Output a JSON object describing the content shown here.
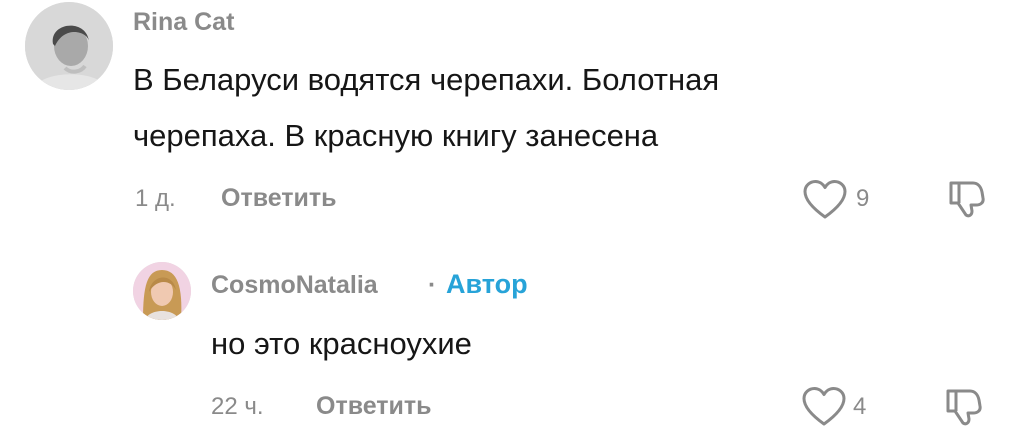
{
  "comments": [
    {
      "username": "Rina Cat",
      "text_lines": [
        "В Беларуси водятся черепахи. Болотная",
        "черепаха. В красную книгу занесена"
      ],
      "time": "1 д.",
      "reply_label": "Ответить",
      "likes": "9",
      "like_icon": "heart-outline-icon",
      "dislike_icon": "thumbs-down-outline-icon"
    },
    {
      "username": "CosmoNatalia",
      "separator": "·",
      "badge": "Автор",
      "text_lines": [
        "но это красноухие"
      ],
      "time": "22 ч.",
      "reply_label": "Ответить",
      "likes": "4",
      "like_icon": "heart-outline-icon",
      "dislike_icon": "thumbs-down-outline-icon"
    }
  ],
  "colors": {
    "meta_gray": "#8a8a8a",
    "text_dark": "#161616",
    "author_badge": "#27a3d8",
    "background": "#ffffff"
  }
}
